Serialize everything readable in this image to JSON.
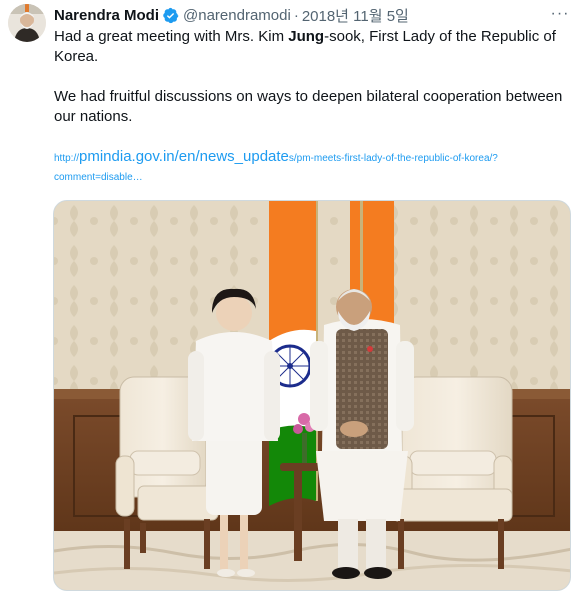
{
  "tweet": {
    "author_name": "Narendra Modi",
    "handle": "@narendramodi",
    "separator": "·",
    "date": "2018년 11월 5일",
    "more_label": "···",
    "text_line1_before": "Had a great meeting with Mrs. Kim ",
    "text_line1_bold": "Jung",
    "text_line1_after": "-sook, First Lady of the Republic of Korea.",
    "text_para2": "We had fruitful discussions on ways to deepen bilateral cooperation between our nations.",
    "link_prefix": "http://",
    "link_main": "pmindia.gov.in/en/news_update",
    "link_suffix": "s/pm-meets-first-lady-of-the-republic-of-korea/?comment=disable…"
  },
  "colors": {
    "text": "#0f1419",
    "secondary": "#536471",
    "link": "#1d9bf0",
    "verified": "#1d9bf0"
  },
  "icons": {
    "verified": "verified-badge-icon",
    "more": "more-options-icon"
  }
}
